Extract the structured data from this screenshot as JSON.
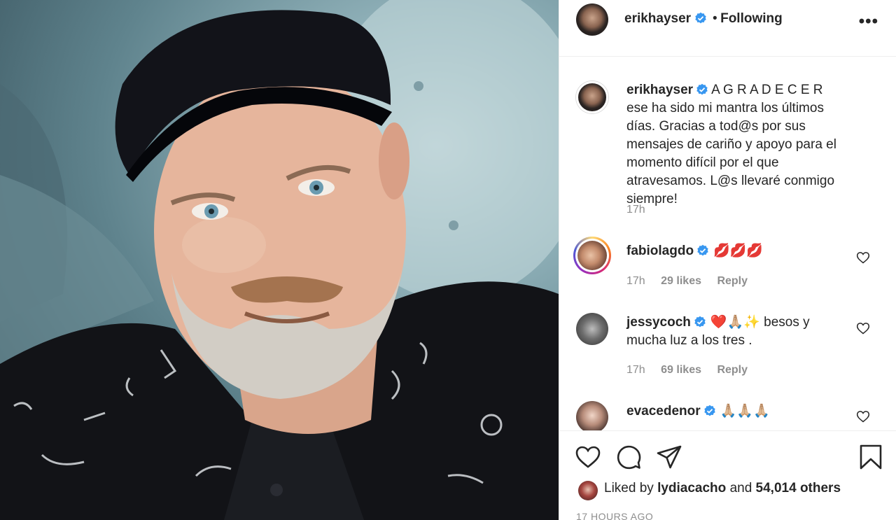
{
  "post": {
    "author": "erikhayser",
    "follow_status": "Following",
    "dot": "•",
    "more_label": "•••"
  },
  "caption": {
    "username": "erikhayser",
    "text": "A G R A D E C E R ese ha sido mi mantra los últimos días. Gracias a tod@s por sus mensajes de cariño y apoyo para el momento difícil por el que atravesamos. L@s llevaré conmigo siempre!",
    "time": "17h"
  },
  "comments": [
    {
      "username": "fabiolagdo",
      "text": "💋💋💋",
      "time": "17h",
      "likes": "29 likes",
      "reply": "Reply"
    },
    {
      "username": "jessycoch",
      "text": "❤️🙏🏼✨ besos y mucha luz a los tres .",
      "time": "17h",
      "likes": "69 likes",
      "reply": "Reply"
    },
    {
      "username": "evacedenor",
      "text": "🙏🏼🙏🏼🙏🏼"
    }
  ],
  "likes": {
    "prefix": "Liked by",
    "user": "lydiacacho",
    "middle": "and",
    "count": "54,014 others"
  },
  "timestamp": "17 HOURS AGO",
  "colors": {
    "verified": "#3897f0",
    "meta_gray": "#8e8e8e",
    "text": "#262626",
    "border": "#efefef"
  },
  "icons": [
    "heart-icon",
    "comment-icon",
    "share-icon",
    "bookmark-icon",
    "verified-badge-icon",
    "more-icon"
  ]
}
